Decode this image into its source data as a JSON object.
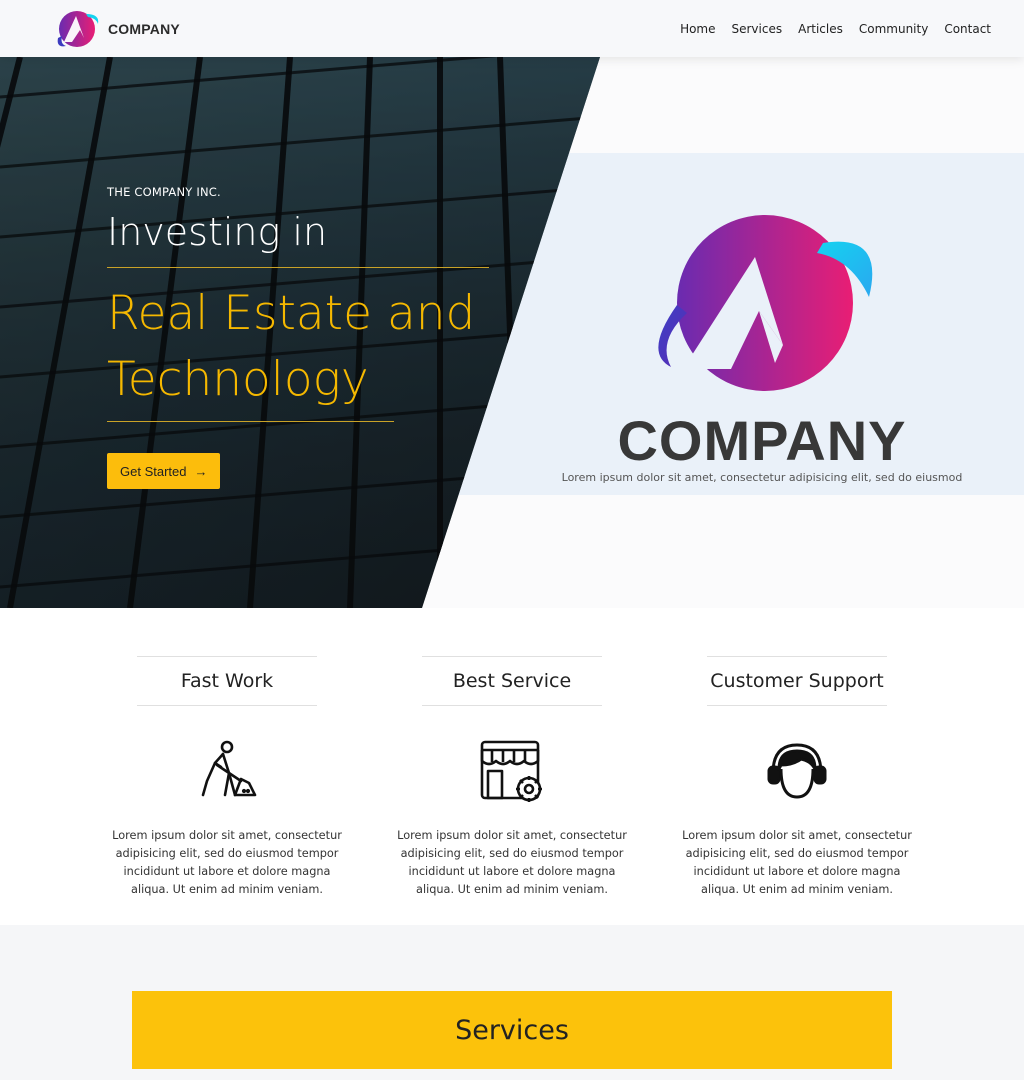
{
  "brand": {
    "name": "COMPANY"
  },
  "nav": {
    "items": [
      "Home",
      "Services",
      "Articles",
      "Community",
      "Contact"
    ]
  },
  "hero": {
    "eyebrow": "THE COMPANY INC.",
    "line1": "Investing in",
    "line2a": "Real Estate and",
    "line2b": "Technology",
    "cta_label": "Get Started",
    "logo_word": "COMPANY",
    "logo_caption": "Lorem ipsum dolor sit amet, consectetur adipisicing elit, sed do eiusmod"
  },
  "features": [
    {
      "title": "Fast Work",
      "icon": "worker-shovel-icon",
      "text": "Lorem ipsum dolor sit amet, consectetur adipisicing elit, sed do eiusmod tempor incididunt ut labore et dolore magna aliqua. Ut enim ad minim veniam."
    },
    {
      "title": "Best Service",
      "icon": "store-gear-icon",
      "text": "Lorem ipsum dolor sit amet, consectetur adipisicing elit, sed do eiusmod tempor incididunt ut labore et dolore magna aliqua. Ut enim ad minim veniam."
    },
    {
      "title": "Customer Support",
      "icon": "headset-icon",
      "text": "Lorem ipsum dolor sit amet, consectetur adipisicing elit, sed do eiusmod tempor incididunt ut labore et dolore magna aliqua. Ut enim ad minim veniam."
    }
  ],
  "services": {
    "title": "Services"
  },
  "colors": {
    "accent": "#fcc20b",
    "headline": "#f5b800",
    "logo_purple": "#6a2bb0",
    "logo_pink": "#e91e74",
    "logo_cyan": "#14d3f0"
  }
}
